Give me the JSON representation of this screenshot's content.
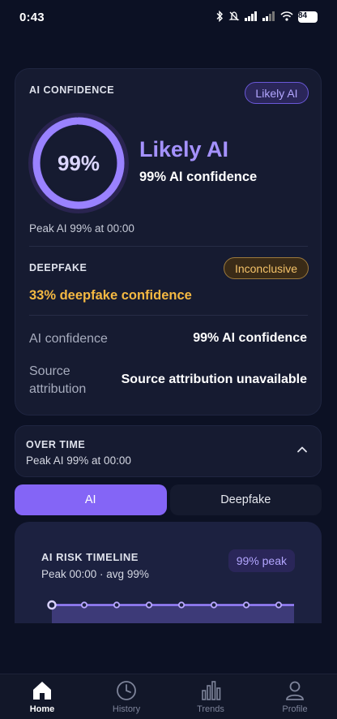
{
  "status_bar": {
    "time": "0:43",
    "battery": "84"
  },
  "ai_card": {
    "section_label": "AI CONFIDENCE",
    "badge": "Likely AI",
    "ring_value": "99%",
    "ring_fraction": 0.99,
    "verdict": "Likely AI",
    "verdict_detail": "99% AI confidence",
    "peak_line": "Peak AI 99% at 00:00",
    "deepfake_label": "DEEPFAKE",
    "deepfake_badge": "Inconclusive",
    "deepfake_confidence": "33% deepfake confidence",
    "rows": [
      {
        "label": "AI confidence",
        "value": "99% AI confidence"
      },
      {
        "label": "Source attribution",
        "value": "Source attribution unavailable"
      }
    ]
  },
  "over_time": {
    "title": "OVER TIME",
    "subtitle": "Peak AI 99% at 00:00"
  },
  "tabs": [
    {
      "label": "AI"
    },
    {
      "label": "Deepfake"
    }
  ],
  "timeline": {
    "title": "AI RISK TIMELINE",
    "subtitle": "Peak 00:00 · avg 99%",
    "badge": "99% peak"
  },
  "chart_data": {
    "type": "area",
    "series": [
      {
        "values": [
          99,
          99,
          99,
          99,
          99,
          99,
          99,
          99
        ]
      }
    ],
    "ylim": [
      0,
      100
    ]
  },
  "nav": [
    {
      "label": "Home",
      "icon": "home-icon"
    },
    {
      "label": "History",
      "icon": "clock-icon"
    },
    {
      "label": "Trends",
      "icon": "bar-chart-icon"
    },
    {
      "label": "Profile",
      "icon": "user-icon"
    }
  ],
  "colors": {
    "accent": "#8465f6",
    "verdict": "#a592ff",
    "warning": "#f5b942",
    "background": "#0c1124",
    "card": "#161b31"
  }
}
